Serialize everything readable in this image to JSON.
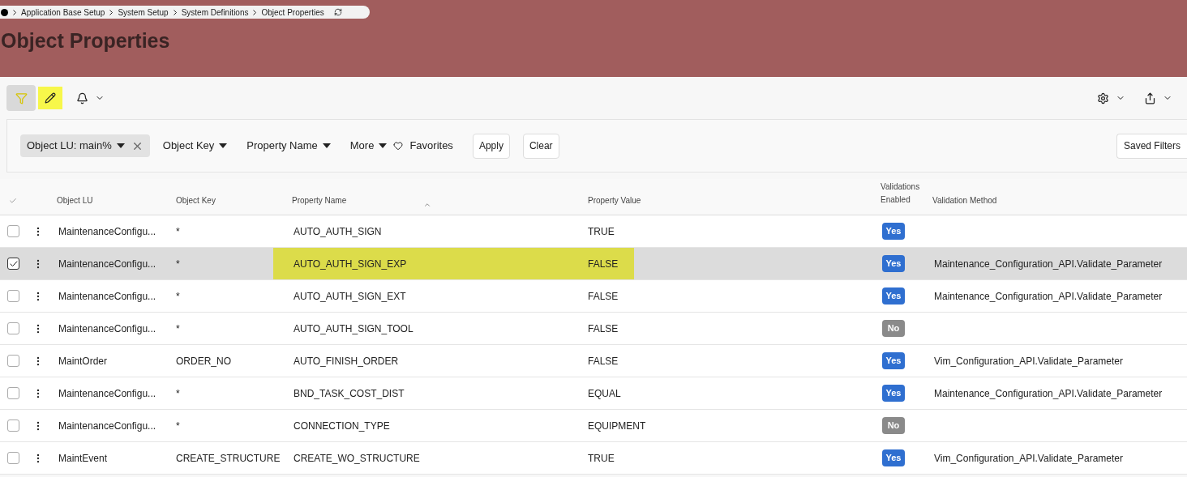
{
  "breadcrumb": {
    "items": [
      "Application Base Setup",
      "System Setup",
      "System Definitions",
      "Object Properties"
    ]
  },
  "page_title": "Object Properties",
  "toolbar": {
    "filter_active": true,
    "edit_highlighted": true
  },
  "filters": {
    "chips": [
      {
        "label": "Object LU: main%",
        "kind": "applied"
      },
      {
        "label": "Object Key",
        "kind": "menu"
      },
      {
        "label": "Property Name",
        "kind": "menu"
      },
      {
        "label": "More",
        "kind": "menu"
      }
    ],
    "favorites": "Favorites",
    "apply": "Apply",
    "clear": "Clear",
    "saved": "Saved Filters"
  },
  "table": {
    "columns": [
      "Object LU",
      "Object Key",
      "Property Name",
      "Property Value",
      "Validations Enabled",
      "Validation Method"
    ],
    "rows": [
      {
        "object_lu": "MaintenanceConfigu...",
        "object_key": "*",
        "property_name": "AUTO_AUTH_SIGN",
        "property_value": "TRUE",
        "validations": "Yes",
        "validations_enabled": true,
        "method": "",
        "selected": false,
        "highlighted": false
      },
      {
        "object_lu": "MaintenanceConfigu...",
        "object_key": "*",
        "property_name": "AUTO_AUTH_SIGN_EXP",
        "property_value": "FALSE",
        "validations": "Yes",
        "validations_enabled": true,
        "method": "Maintenance_Configuration_API.Validate_Parameter",
        "selected": true,
        "highlighted": true
      },
      {
        "object_lu": "MaintenanceConfigu...",
        "object_key": "*",
        "property_name": "AUTO_AUTH_SIGN_EXT",
        "property_value": "FALSE",
        "validations": "Yes",
        "validations_enabled": true,
        "method": "Maintenance_Configuration_API.Validate_Parameter",
        "selected": false,
        "highlighted": false
      },
      {
        "object_lu": "MaintenanceConfigu...",
        "object_key": "*",
        "property_name": "AUTO_AUTH_SIGN_TOOL",
        "property_value": "FALSE",
        "validations": "No",
        "validations_enabled": false,
        "method": "",
        "selected": false,
        "highlighted": false
      },
      {
        "object_lu": "MaintOrder",
        "object_key": "ORDER_NO",
        "property_name": "AUTO_FINISH_ORDER",
        "property_value": "FALSE",
        "validations": "Yes",
        "validations_enabled": true,
        "method": "Vim_Configuration_API.Validate_Parameter",
        "selected": false,
        "highlighted": false
      },
      {
        "object_lu": "MaintenanceConfigu...",
        "object_key": "*",
        "property_name": "BND_TASK_COST_DIST",
        "property_value": "EQUAL",
        "validations": "Yes",
        "validations_enabled": true,
        "method": "Maintenance_Configuration_API.Validate_Parameter",
        "selected": false,
        "highlighted": false
      },
      {
        "object_lu": "MaintenanceConfigu...",
        "object_key": "*",
        "property_name": "CONNECTION_TYPE",
        "property_value": "EQUIPMENT",
        "validations": "No",
        "validations_enabled": false,
        "method": "",
        "selected": false,
        "highlighted": false
      },
      {
        "object_lu": "MaintEvent",
        "object_key": "CREATE_STRUCTURE",
        "property_name": "CREATE_WO_STRUCTURE",
        "property_value": "TRUE",
        "validations": "Yes",
        "validations_enabled": true,
        "method": "Vim_Configuration_API.Validate_Parameter",
        "selected": false,
        "highlighted": false
      }
    ]
  }
}
